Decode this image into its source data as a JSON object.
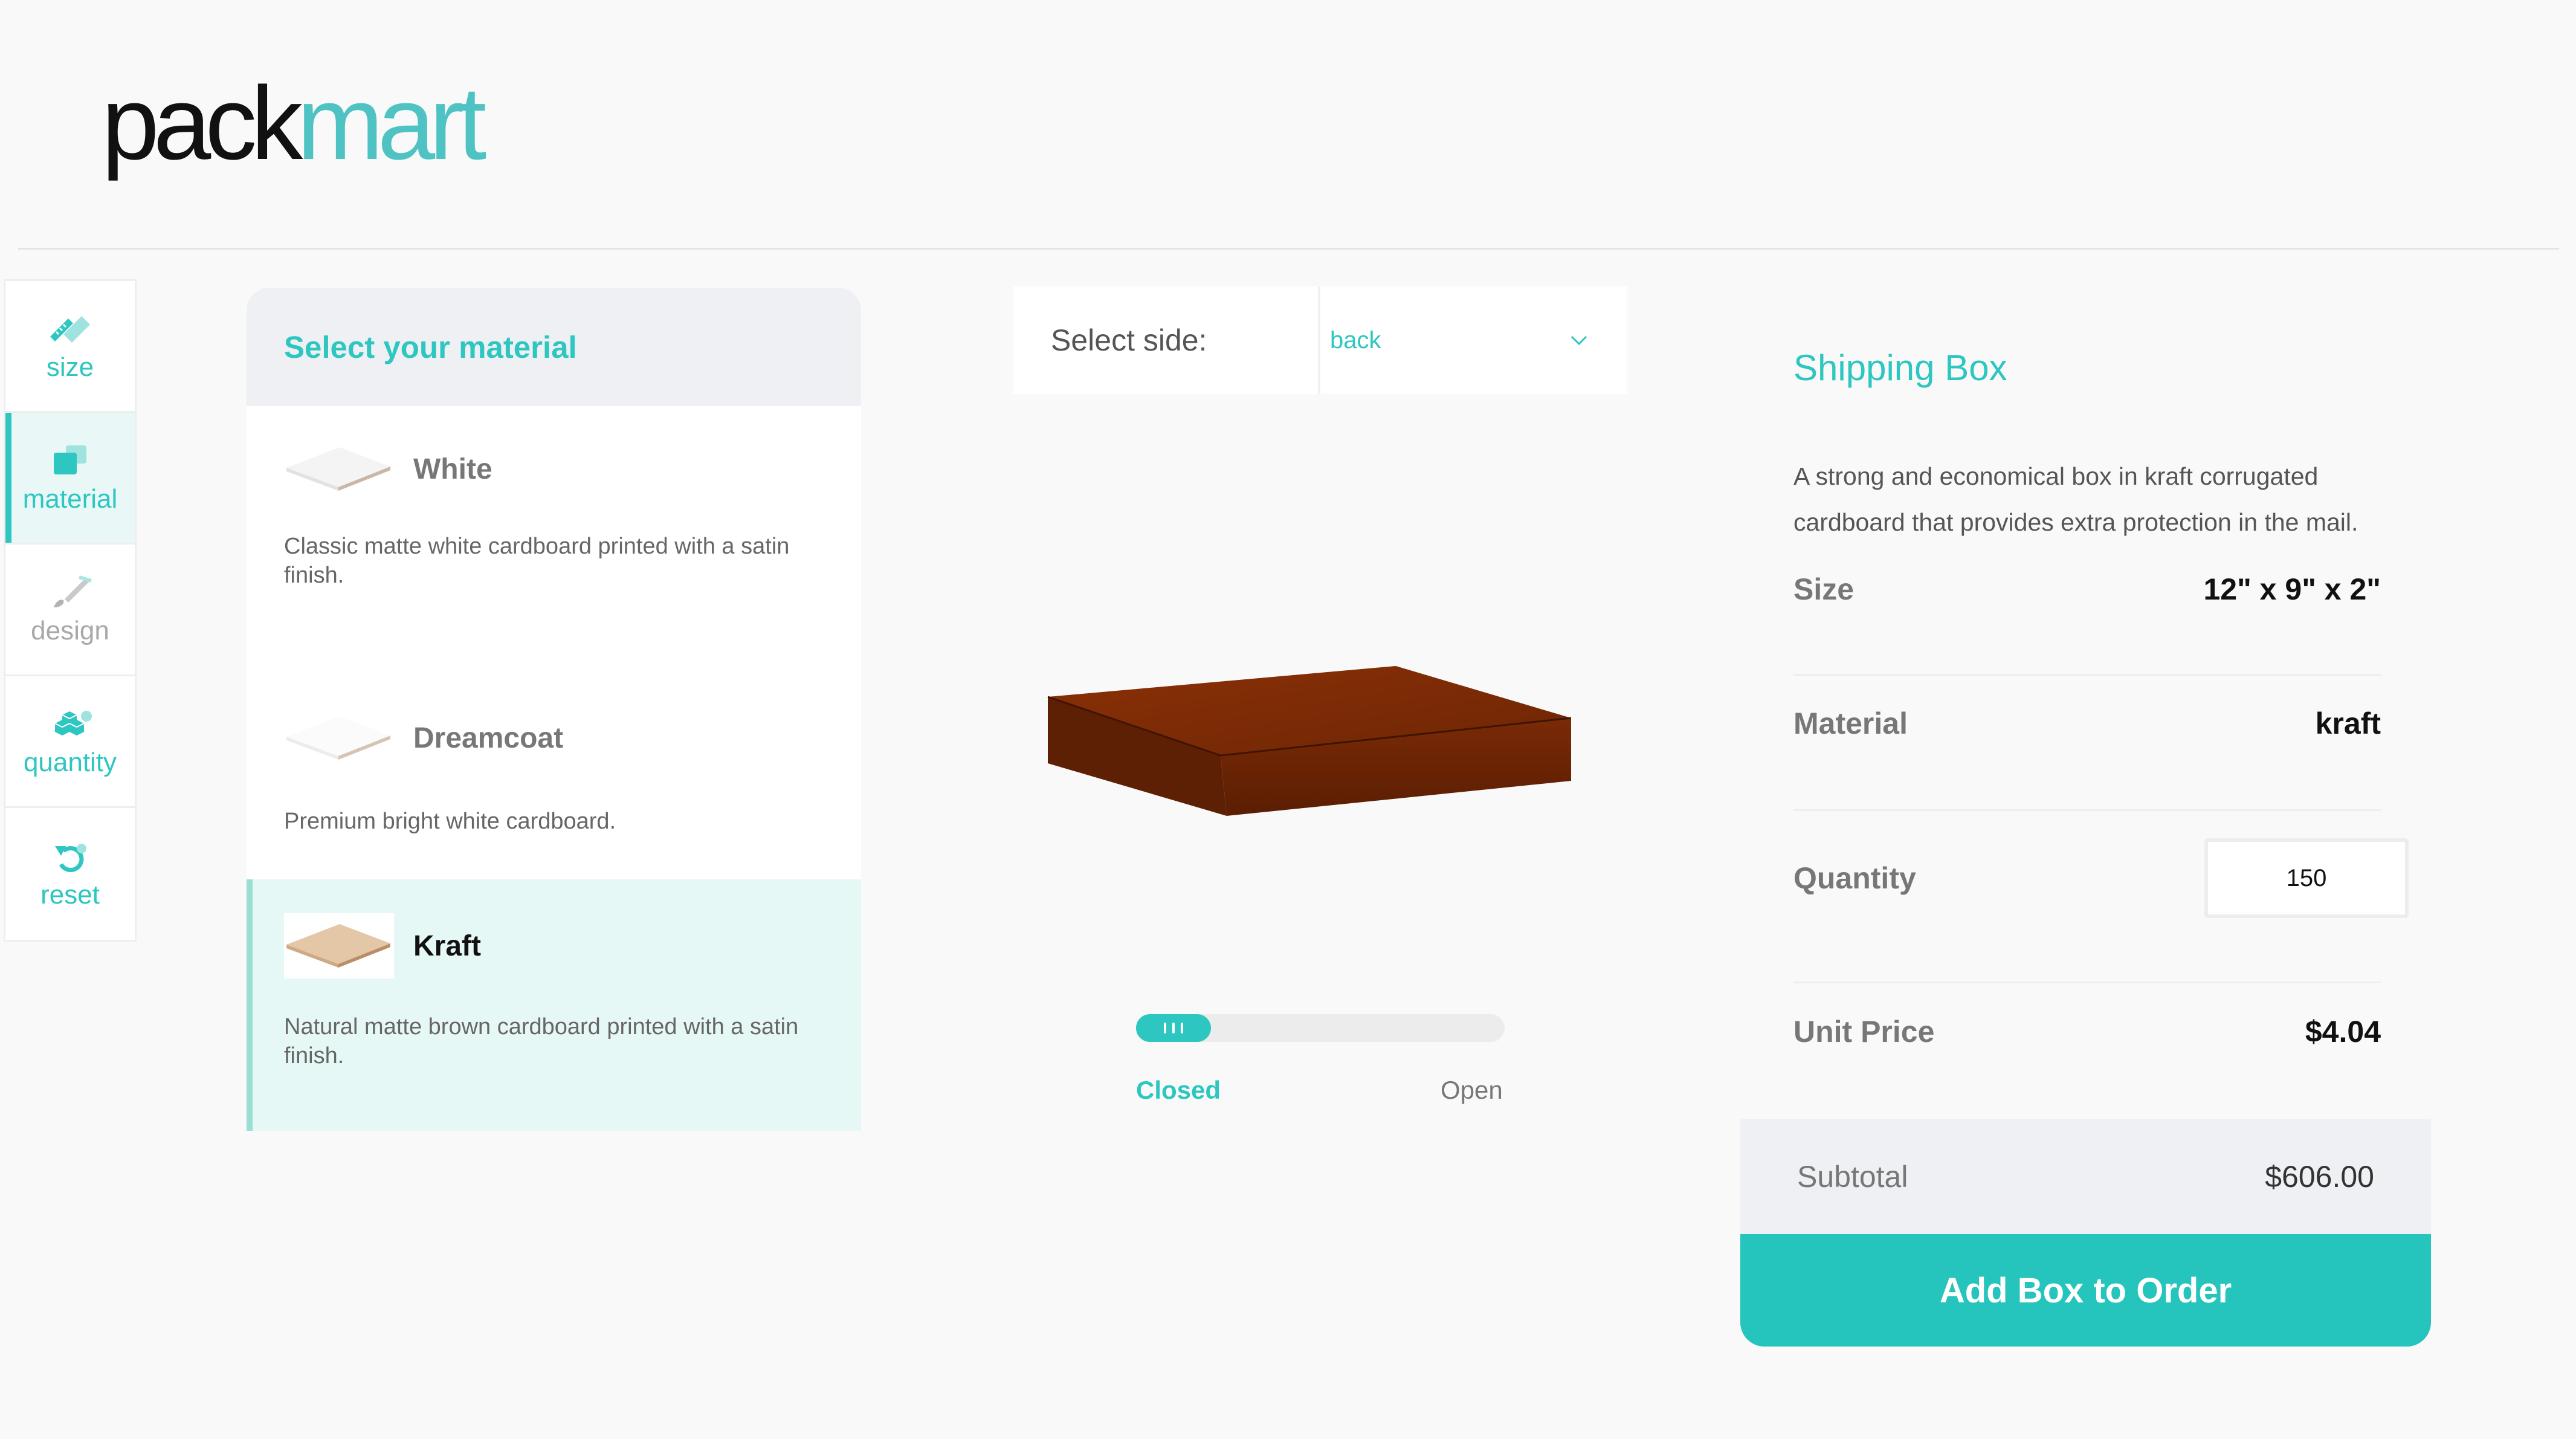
{
  "brand": {
    "logo_part1": "pack",
    "logo_part2": "mart",
    "accent": "#2dc6c0"
  },
  "rail": {
    "items": [
      {
        "label": "size",
        "icon": "ruler-icon",
        "state": "default"
      },
      {
        "label": "material",
        "icon": "material-swatch-icon",
        "state": "active"
      },
      {
        "label": "design",
        "icon": "paintbrush-icon",
        "state": "disabled"
      },
      {
        "label": "quantity",
        "icon": "boxes-icon",
        "state": "default"
      },
      {
        "label": "reset",
        "icon": "reset-icon",
        "state": "default"
      }
    ]
  },
  "material_panel": {
    "title": "Select your material",
    "items": [
      {
        "name": "White",
        "description": "Classic matte white cardboard printed with a satin finish.",
        "selected": false
      },
      {
        "name": "Dreamcoat",
        "description": "Premium bright white cardboard.",
        "selected": false
      },
      {
        "name": "Kraft",
        "description": "Natural matte brown cardboard printed with a satin finish.",
        "selected": true
      }
    ]
  },
  "viewer": {
    "side_label": "Select side:",
    "side_value": "back",
    "box_color": "#7a2a06",
    "fold_closed_label": "Closed",
    "fold_open_label": "Open",
    "fold_state": "closed"
  },
  "summary": {
    "title": "Shipping Box",
    "description": "A strong and economical box in kraft corrugated cardboard that provides extra protection in the mail.",
    "size_label": "Size",
    "size_value": "12\" x 9\" x 2\"",
    "material_label": "Material",
    "material_value": "kraft",
    "quantity_label": "Quantity",
    "quantity_value": "150",
    "unit_price_label": "Unit Price",
    "unit_price_value": "$4.04",
    "subtotal_label": "Subtotal",
    "subtotal_value": "$606.00",
    "add_button_label": "Add Box to Order"
  }
}
